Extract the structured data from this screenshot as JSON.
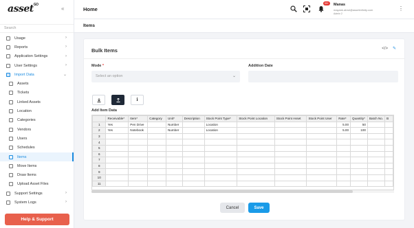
{
  "sidebar": {
    "logo": "asset",
    "logo_sup": "GO",
    "search_placeholder": "Search",
    "items": [
      {
        "label": "Usage",
        "sub": false,
        "chevron": true
      },
      {
        "label": "Reports",
        "sub": false,
        "chevron": true
      },
      {
        "label": "Application Settings",
        "sub": false,
        "chevron": true
      },
      {
        "label": "User Settings",
        "sub": false,
        "chevron": true
      },
      {
        "label": "Import Data",
        "sub": false,
        "chevron": true,
        "active": true
      },
      {
        "label": "Assets",
        "sub": true
      },
      {
        "label": "Tickets",
        "sub": true
      },
      {
        "label": "Linked Assets",
        "sub": true
      },
      {
        "label": "Location",
        "sub": true
      },
      {
        "label": "Categories",
        "sub": true
      },
      {
        "label": "Vendors",
        "sub": true
      },
      {
        "label": "Users",
        "sub": true
      },
      {
        "label": "Schedules",
        "sub": true
      },
      {
        "label": "Items",
        "sub": true,
        "selected": true
      },
      {
        "label": "Move Items",
        "sub": true
      },
      {
        "label": "Draw Items",
        "sub": true
      },
      {
        "label": "Upload Asset Files",
        "sub": true
      },
      {
        "label": "Support Settings",
        "sub": false,
        "chevron": true
      },
      {
        "label": "System Logs",
        "sub": false,
        "chevron": true
      }
    ],
    "help_label": "Help & Support"
  },
  "topbar": {
    "title": "Home",
    "notification_count": "99+",
    "user_name": "Manas",
    "user_email": "mayank.abrol@assetinfinity.com",
    "user_role": "Admin 2"
  },
  "subheader": {
    "title": "Items"
  },
  "card": {
    "title": "Bulk Items",
    "mode_label": "Mode",
    "mode_required": "*",
    "mode_placeholder": "Select an option",
    "addition_date_label": "Addition Date",
    "add_item_data_label": "Add Item Data",
    "cancel_label": "Cancel",
    "save_label": "Save"
  },
  "grid": {
    "columns": [
      "",
      "Receivable*",
      "Item*",
      "Category",
      "Unit*",
      "Description",
      "Stock Point Type*",
      "Stock Point Location",
      "Stock Point Asset",
      "Stock Point User",
      "Rate*",
      "Quantity*",
      "Batch No.",
      "B"
    ],
    "rows": [
      [
        "1",
        "Yes",
        "Pen Drive",
        "",
        "Number",
        "",
        "Location",
        "",
        "",
        "",
        "5.00",
        "50",
        "",
        ""
      ],
      [
        "2",
        "Yes",
        "Notebook",
        "",
        "Number",
        "",
        "Location",
        "",
        "",
        "",
        "5.00",
        "100",
        "",
        ""
      ],
      [
        "3",
        "",
        "",
        "",
        "",
        "",
        "",
        "",
        "",
        "",
        "",
        "",
        "",
        ""
      ],
      [
        "4",
        "",
        "",
        "",
        "",
        "",
        "",
        "",
        "",
        "",
        "",
        "",
        "",
        ""
      ],
      [
        "5",
        "",
        "",
        "",
        "",
        "",
        "",
        "",
        "",
        "",
        "",
        "",
        "",
        ""
      ],
      [
        "6",
        "",
        "",
        "",
        "",
        "",
        "",
        "",
        "",
        "",
        "",
        "",
        "",
        ""
      ],
      [
        "7",
        "",
        "",
        "",
        "",
        "",
        "",
        "",
        "",
        "",
        "",
        "",
        "",
        ""
      ],
      [
        "8",
        "",
        "",
        "",
        "",
        "",
        "",
        "",
        "",
        "",
        "",
        "",
        "",
        ""
      ],
      [
        "9",
        "",
        "",
        "",
        "",
        "",
        "",
        "",
        "",
        "",
        "",
        "",
        "",
        ""
      ],
      [
        "10",
        "",
        "",
        "",
        "",
        "",
        "",
        "",
        "",
        "",
        "",
        "",
        "",
        ""
      ],
      [
        "11",
        "",
        "",
        "",
        "",
        "",
        "",
        "",
        "",
        "",
        "",
        "",
        "",
        ""
      ]
    ]
  },
  "colors": {
    "accent": "#1a9be8",
    "help": "#e8604c",
    "dark_button": "#1f2937"
  }
}
